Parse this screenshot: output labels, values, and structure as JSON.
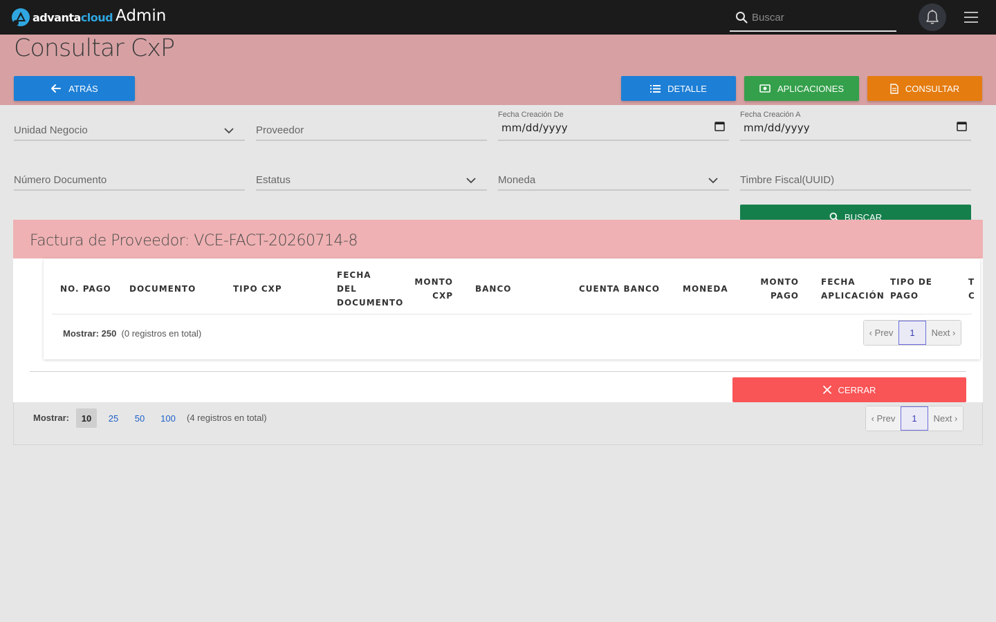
{
  "topbar": {
    "logo_text_a": "advanta",
    "logo_text_b": "cloud",
    "app_title": "Admin",
    "search_placeholder": "Buscar",
    "accent": "#2fa6e0"
  },
  "page": {
    "title": "Consultar CxP",
    "buttons": {
      "back": "ATRÁS",
      "detalle": "DETALLE",
      "aplicaciones": "APLICACIONES",
      "consultar": "CONSULTAR",
      "buscar": "BUSCAR"
    },
    "filters": {
      "unidad_negocio": "Unidad Negocio",
      "proveedor": "Proveedor",
      "fecha_de_label": "Fecha Creación De",
      "fecha_de_value": "mm/dd/yyyy",
      "fecha_a_label": "Fecha Creación A",
      "fecha_a_value": "mm/dd/yyyy",
      "numero_documento": "Número Documento",
      "estatus": "Estatus",
      "moneda": "Moneda",
      "timbre": "Timbre Fiscal(UUID)"
    },
    "list_footer": {
      "mostrar": "Mostrar:",
      "page_sizes": [
        "10",
        "25",
        "50",
        "100"
      ],
      "selected_page_size": "10",
      "total": "(4 registros en total)",
      "prev": "‹ Prev",
      "current": "1",
      "next": "Next ›"
    }
  },
  "modal": {
    "title": "Factura de Proveedor: VCE-FACT-20260714-8",
    "columns": {
      "no_pago": "NO. PAGO",
      "documento": "DOCUMENTO",
      "tipo_cxp": "TIPO CXP",
      "fecha_doc_1": "FECHA",
      "fecha_doc_2": "DEL",
      "fecha_doc_3": "DOCUMENTO",
      "monto_cxp_1": "MONTO",
      "monto_cxp_2": "CXP",
      "banco": "BANCO",
      "cuenta_banco": "CUENTA BANCO",
      "moneda": "MONEDA",
      "monto_pago_1": "MONTO",
      "monto_pago_2": "PAGO",
      "fecha_apl_1": "FECHA",
      "fecha_apl_2": "APLICACIÓN",
      "tipo_pago_1": "TIPO DE",
      "tipo_pago_2": "PAGO",
      "cut_1": "T",
      "cut_2": "C"
    },
    "footer": {
      "mostrar_label": "Mostrar: 250",
      "total": "(0 registros en total)",
      "prev": "‹ Prev",
      "current": "1",
      "next": "Next ›"
    },
    "close": "CERRAR"
  }
}
